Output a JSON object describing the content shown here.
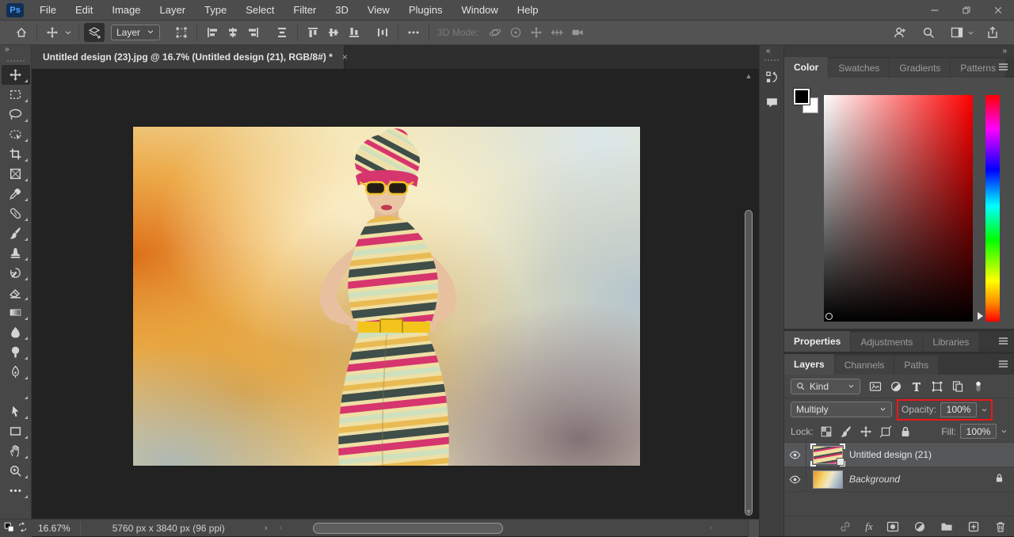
{
  "window": {
    "app": "Adobe Photoshop",
    "controls": {
      "minimize": "minimize",
      "restore": "restore-down",
      "close": "close"
    }
  },
  "menubar": {
    "logo_text": "Ps",
    "items": [
      "File",
      "Edit",
      "Image",
      "Layer",
      "Type",
      "Select",
      "Filter",
      "3D",
      "View",
      "Plugins",
      "Window",
      "Help"
    ]
  },
  "options_bar": {
    "tool_preset_dropdown": "Layer",
    "mode_label": "3D Mode:"
  },
  "document_tab": {
    "title": "Untitled design (23).jpg @ 16.7% (Untitled design (21), RGB/8#) *",
    "close_glyph": "×"
  },
  "toolbar": {
    "collapse_glyph": "»",
    "tools": [
      {
        "name": "move-tool",
        "icon": "move",
        "active": true
      },
      {
        "name": "rectangular-marquee-tool",
        "icon": "marquee"
      },
      {
        "name": "lasso-tool",
        "icon": "lasso"
      },
      {
        "name": "object-selection-tool",
        "icon": "object-select"
      },
      {
        "name": "crop-tool",
        "icon": "crop"
      },
      {
        "name": "frame-tool",
        "icon": "frame"
      },
      {
        "name": "eyedropper-tool",
        "icon": "eyedropper"
      },
      {
        "name": "spot-healing-brush-tool",
        "icon": "healing"
      },
      {
        "name": "brush-tool",
        "icon": "brush"
      },
      {
        "name": "clone-stamp-tool",
        "icon": "clone-stamp"
      },
      {
        "name": "history-brush-tool",
        "icon": "history-brush"
      },
      {
        "name": "eraser-tool",
        "icon": "eraser"
      },
      {
        "name": "gradient-tool",
        "icon": "gradient"
      },
      {
        "name": "blur-tool",
        "icon": "blur"
      },
      {
        "name": "dodge-tool",
        "icon": "dodge"
      },
      {
        "name": "pen-tool",
        "icon": "pen"
      },
      {
        "name": "type-tool",
        "icon": "type"
      },
      {
        "name": "path-selection-tool",
        "icon": "path-select"
      },
      {
        "name": "rectangle-tool",
        "icon": "rectangle"
      },
      {
        "name": "hand-tool",
        "icon": "hand"
      },
      {
        "name": "zoom-tool",
        "icon": "zoom"
      },
      {
        "name": "edit-toolbar",
        "icon": "ellipsis"
      }
    ]
  },
  "canvas": {
    "artwork_description": "Fashion photo: woman in striped turban and striped dress with yellow sunglasses and yellow belt, hands on hips, on orange-yellow-blue watercolor background"
  },
  "status_bar": {
    "zoom": "16.67%",
    "doc_info": "5760 px x 3840 px (96 ppi)",
    "chevron": "›",
    "scroll_left": "‹",
    "scroll_right": "›"
  },
  "dock": {
    "collapse_left_glyph": "«",
    "collapse_right_glyph": "»"
  },
  "panels": {
    "color_group": {
      "tabs": [
        "Color",
        "Swatches",
        "Gradients",
        "Patterns"
      ],
      "active": "Color"
    },
    "properties_group": {
      "tabs": [
        "Properties",
        "Adjustments",
        "Libraries"
      ],
      "active": "Properties"
    },
    "layers_group": {
      "tabs": [
        "Layers",
        "Channels",
        "Paths"
      ],
      "active": "Layers",
      "filter_label": "Kind",
      "blend_mode": "Multiply",
      "opacity_label": "Opacity:",
      "opacity_value": "100%",
      "lock_label": "Lock:",
      "fill_label": "Fill:",
      "fill_value": "100%",
      "layers": [
        {
          "name": "Untitled design (21)",
          "visible": true,
          "selected": true,
          "smart_object": true,
          "italic": false,
          "locked": false
        },
        {
          "name": "Background",
          "visible": true,
          "selected": false,
          "smart_object": false,
          "italic": true,
          "locked": true
        }
      ]
    }
  },
  "colors": {
    "highlight_red": "#ee1616",
    "foreground_swatch": "#000000",
    "background_swatch": "#ffffff",
    "accent_blue_logo": "#4da3ff"
  }
}
